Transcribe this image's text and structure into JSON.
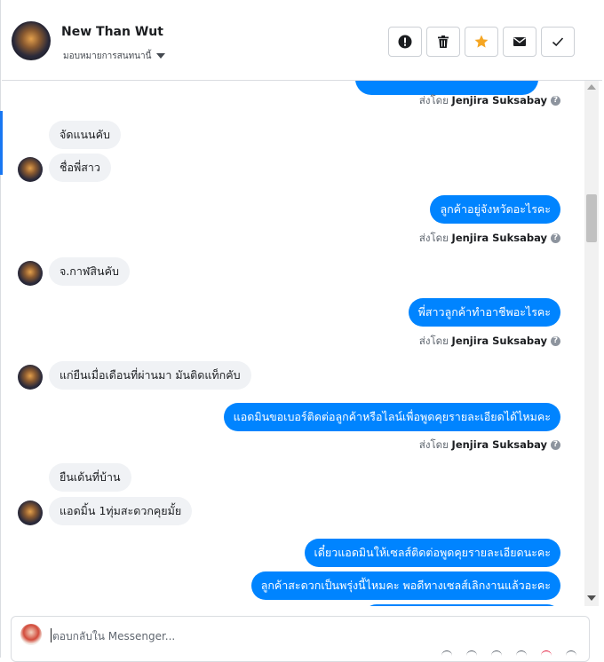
{
  "header": {
    "name": "New Than Wut",
    "assign_label": "มอบหมายการสนทนานี้",
    "buttons": [
      {
        "name": "mark-spam",
        "icon": "exclamation-icon"
      },
      {
        "name": "delete",
        "icon": "trash-icon"
      },
      {
        "name": "star",
        "icon": "star-icon",
        "color": "#f5a623"
      },
      {
        "name": "unread",
        "icon": "envelope-icon"
      },
      {
        "name": "done",
        "icon": "check-icon"
      }
    ]
  },
  "sent_by_prefix": "ส่งโดย",
  "agent_name": "Jenjira Suksabay",
  "messages": {
    "in_1": "จัดแนนคับ",
    "in_2": "ชื่อพี่สาว",
    "out_1": "ลูกค้าอยู่จังหวัดอะไรคะ",
    "in_3": "จ.กาฬสินคับ",
    "out_2": "พี่สาวลูกค้าทำอาชีพอะไรคะ",
    "in_4": "แก่ยืนเมื่อเดือนที่ผ่านมา มันติดแท็กคับ",
    "out_3": "แอดมินขอเบอร์ติดต่อลูกค้าหรือไลน์เพื่อพูดคุยรายละเอียดได้ไหมคะ",
    "in_5": "ยืนเด้นที่บ้าน",
    "in_6": "แอดมิ้น 1ทุ่มสะดวกคุยมั้ย",
    "out_4": "เดี๋ยวแอดมินให้เซลส์ติดต่อพูดคุยรายละเอียดนะคะ",
    "out_5": "ลูกค้าสะดวกเป็นพรุ่งนี้ไหมคะ พอดีทางเซลส์เลิกงานแล้วอะคะ"
  },
  "composer": {
    "placeholder": "ตอบกลับใน Messenger..."
  },
  "colors": {
    "accent": "#0084ff",
    "incoming_bubble": "#f0f2f5",
    "star": "#f5a623"
  }
}
